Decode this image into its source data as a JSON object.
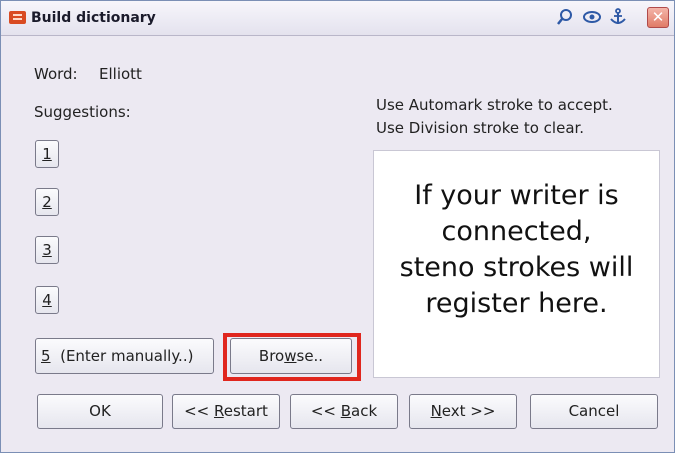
{
  "window": {
    "title": "Build dictionary",
    "close_symbol": "✕",
    "titlebar_icons": [
      "magnifier-icon",
      "eye-icon",
      "anchor-icon"
    ]
  },
  "word_label": "Word:",
  "word_value": "Elliott",
  "suggestions_label": "Suggestions:",
  "suggestion_buttons": [
    "1",
    "2",
    "3",
    "4"
  ],
  "enter_manually": {
    "num": "5",
    "text": "(Enter manually..)"
  },
  "browse": {
    "pre": "Bro",
    "mnemonic": "w",
    "post": "se.."
  },
  "instructions": {
    "line1": "Use Automark stroke to accept.",
    "line2": "Use Division stroke to clear."
  },
  "stroke_box": {
    "line1": "If your writer is",
    "line2": "connected,",
    "line3": "steno strokes will",
    "line4": "register here."
  },
  "buttons": {
    "ok": "OK",
    "restart_pre": "<< ",
    "restart_mn": "R",
    "restart_post": "estart",
    "back_pre": "<< ",
    "back_mn": "B",
    "back_post": "ack",
    "next_mn": "N",
    "next_post": "ext >>",
    "cancel": "Cancel"
  },
  "colors": {
    "highlight": "#e0261e",
    "accent": "#2e59a6"
  }
}
